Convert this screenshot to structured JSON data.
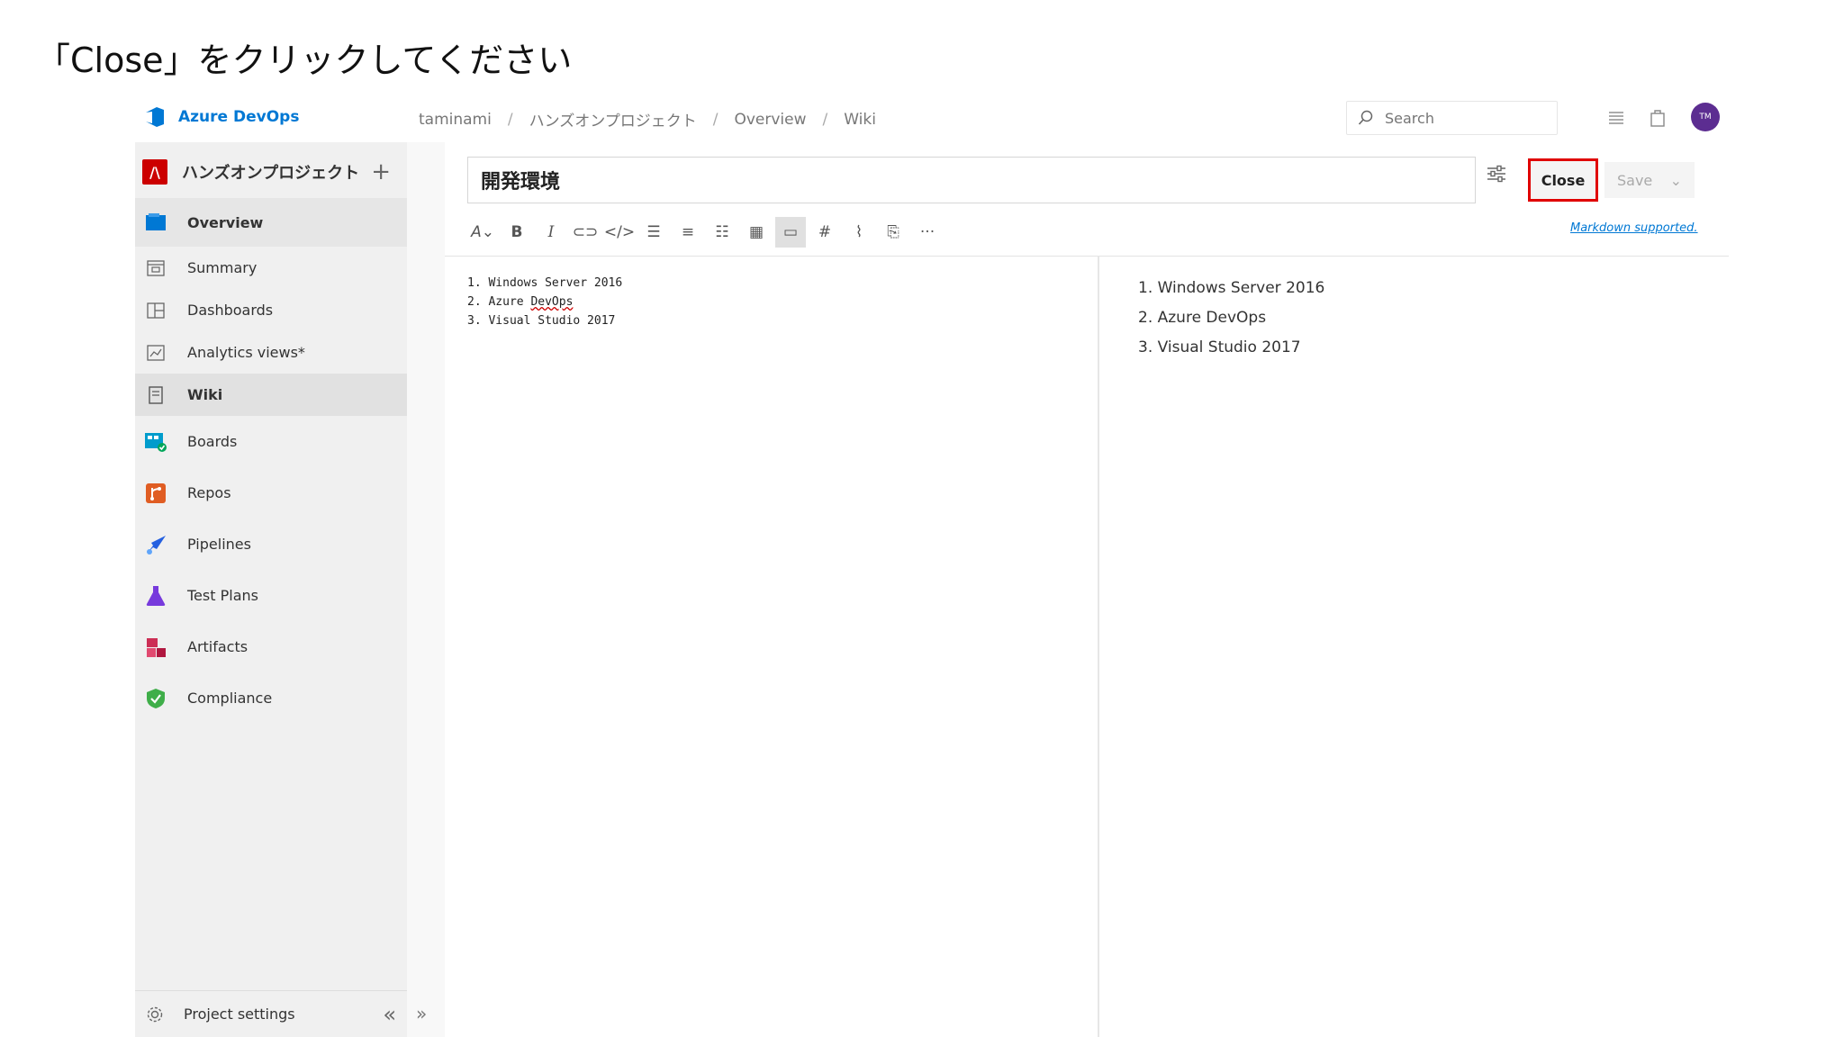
{
  "instruction": "「Close」をクリックしてください",
  "topbar": {
    "brand": "Azure DevOps",
    "breadcrumbs": [
      "taminami",
      "ハンズオンプロジェクト",
      "Overview",
      "Wiki"
    ],
    "search_placeholder": "Search",
    "avatar_initials": "TM"
  },
  "sidebar": {
    "project_initial": "/\\",
    "project_name": "ハンズオンプロジェクト",
    "items": [
      {
        "label": "Overview"
      },
      {
        "label": "Summary"
      },
      {
        "label": "Dashboards"
      },
      {
        "label": "Analytics views*"
      },
      {
        "label": "Wiki"
      },
      {
        "label": "Boards"
      },
      {
        "label": "Repos"
      },
      {
        "label": "Pipelines"
      },
      {
        "label": "Test Plans"
      },
      {
        "label": "Artifacts"
      },
      {
        "label": "Compliance"
      }
    ],
    "settings_label": "Project settings"
  },
  "editor": {
    "title_value": "開発環境",
    "close_label": "Close",
    "save_label": "Save",
    "markdown_link": "Markdown supported.",
    "source_lines": [
      "1. Windows Server 2016",
      "2. Azure ",
      "DevOps",
      "3. Visual Studio 2017"
    ],
    "preview_items": [
      "1. Windows Server 2016",
      "2. Azure DevOps",
      "3. Visual Studio 2017"
    ]
  },
  "colors": {
    "accent": "#0078d4",
    "highlight": "#e00000"
  }
}
